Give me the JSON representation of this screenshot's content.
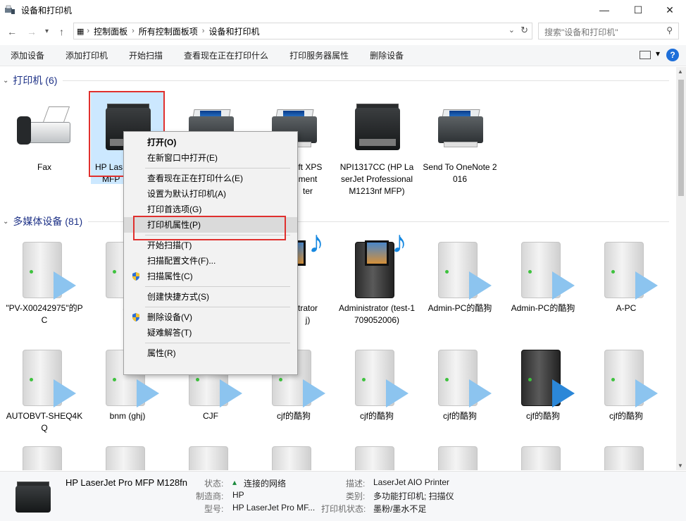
{
  "window": {
    "title": "设备和打印机",
    "controls": {
      "minimize": "—",
      "maximize": "☐",
      "close": "✕"
    }
  },
  "address": {
    "crumbs": [
      "控制面板",
      "所有控制面板项",
      "设备和打印机"
    ],
    "search_placeholder": "搜索\"设备和打印机\""
  },
  "toolbar": {
    "items": [
      "添加设备",
      "添加打印机",
      "开始扫描",
      "查看现在正在打印什么",
      "打印服务器属性",
      "删除设备"
    ],
    "help": "?"
  },
  "groups": {
    "printers": {
      "title": "打印机 (6)"
    },
    "media": {
      "title": "多媒体设备 (81)"
    }
  },
  "printers": [
    {
      "label": "Fax",
      "icon": "fax-icon"
    },
    {
      "label": "HP LaserJet Pro MFP M128fn",
      "short": "HP Las",
      "short2": "MFP",
      "icon": "mfp-printer-icon"
    },
    {
      "label": "",
      "icon": "printer-icon"
    },
    {
      "label": "Microsoft XPS Document Writer",
      "short": "oft XPS",
      "short2": "ment",
      "short3": "ter",
      "icon": "printer-icon"
    },
    {
      "label": "NPI1317CC (HP LaserJet Professional M1213nf MFP)",
      "icon": "mfp-printer-icon"
    },
    {
      "label": "Send To OneNote 2016",
      "icon": "printer-icon"
    }
  ],
  "media_row1": [
    {
      "label": "\"PV-X00242975\"的PC"
    },
    {
      "label": "aa"
    },
    {
      "label": ""
    },
    {
      "label": "trator",
      "label2": "j)"
    },
    {
      "label": "Administrator (test-1709052006)"
    },
    {
      "label": "Admin-PC的酷狗"
    },
    {
      "label": "Admin-PC的酷狗"
    },
    {
      "label": "A-PC"
    }
  ],
  "media_row2": [
    {
      "label": "AUTOBVT-SHEQ4KQ"
    },
    {
      "label": "bnm (ghj)"
    },
    {
      "label": "CJF"
    },
    {
      "label": "cjf的酷狗"
    },
    {
      "label": "cjf的酷狗"
    },
    {
      "label": "cjf的酷狗"
    },
    {
      "label": "cjf的酷狗"
    },
    {
      "label": "cjf的酷狗"
    }
  ],
  "context_menu": {
    "open": "打开(O)",
    "open_new": "在新窗口中打开(E)",
    "see_printing": "查看现在正在打印什么(E)",
    "set_default": "设置为默认打印机(A)",
    "print_prefs": "打印首选项(G)",
    "printer_props": "打印机属性(P)",
    "start_scan": "开始扫描(T)",
    "scan_profiles": "扫描配置文件(F)...",
    "scan_props": "扫描属性(C)",
    "create_shortcut": "创建快捷方式(S)",
    "remove_device": "删除设备(V)",
    "troubleshoot": "疑难解答(T)",
    "properties": "属性(R)"
  },
  "details": {
    "name": "HP LaserJet Pro MFP M128fn",
    "status_label": "状态:",
    "status_value": "连接的网络",
    "maker_label": "制造商:",
    "maker_value": "HP",
    "model_label": "型号:",
    "model_value": "HP LaserJet Pro MF...",
    "desc_label": "描述:",
    "desc_value": "LaserJet AIO Printer",
    "category_label": "类别:",
    "category_value": "多功能打印机; 扫描仪",
    "printer_status_label": "打印机状态:",
    "printer_status_value": "墨粉/墨水不足"
  },
  "colors": {
    "accent": "#1e6fd9",
    "group_title": "#1e3287",
    "highlight_box": "#e0302e",
    "selection": "#cce8ff"
  }
}
